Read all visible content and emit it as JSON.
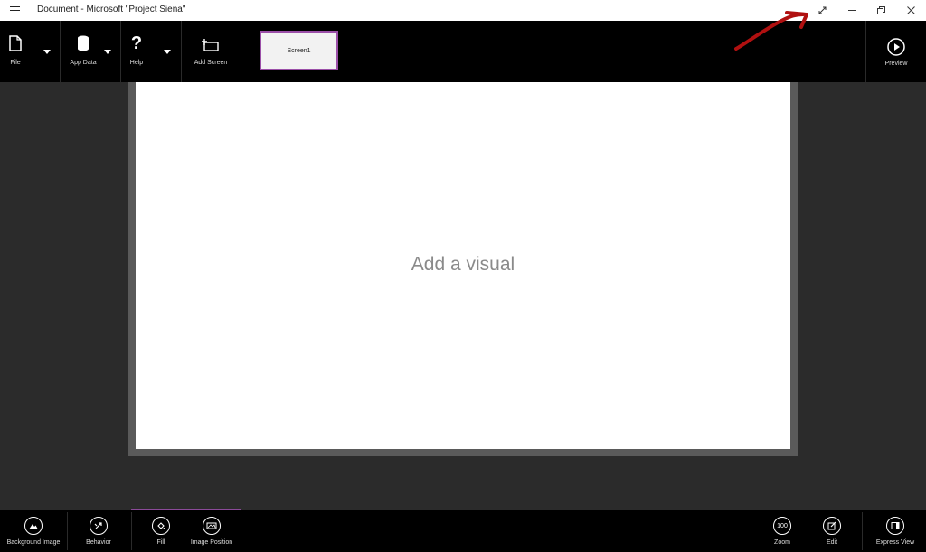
{
  "window": {
    "title": "Document - Microsoft \"Project Siena\"",
    "menu_icon": "hamburger-icon",
    "controls": [
      "full-screen-icon",
      "minimize-icon",
      "restore-icon",
      "close-icon"
    ]
  },
  "ribbon": {
    "file": {
      "label": "File",
      "icon": "file-icon"
    },
    "app_data": {
      "label": "App Data",
      "icon": "database-icon"
    },
    "help": {
      "label": "Help",
      "icon": "question-icon"
    },
    "add_screen": {
      "label": "Add Screen",
      "icon": "add-screen-icon"
    },
    "screens": [
      {
        "label": "Screen1",
        "selected": true
      }
    ],
    "preview": {
      "label": "Preview",
      "icon": "play-circle-icon"
    }
  },
  "canvas": {
    "placeholder": "Add a visual"
  },
  "bottombar": {
    "background_image": {
      "label": "Background Image",
      "icon": "mountain-icon"
    },
    "behavior": {
      "label": "Behavior",
      "icon": "behavior-icon"
    },
    "fill": {
      "label": "Fill",
      "icon": "paint-bucket-icon"
    },
    "image_position": {
      "label": "Image Position",
      "icon": "image-position-icon"
    },
    "zoom": {
      "label": "Zoom",
      "value": "100"
    },
    "edit": {
      "label": "Edit",
      "icon": "edit-icon"
    },
    "express_view": {
      "label": "Express View",
      "icon": "express-view-icon"
    }
  },
  "colors": {
    "accent": "#9b4fa8",
    "annotation_arrow": "#b01010"
  }
}
